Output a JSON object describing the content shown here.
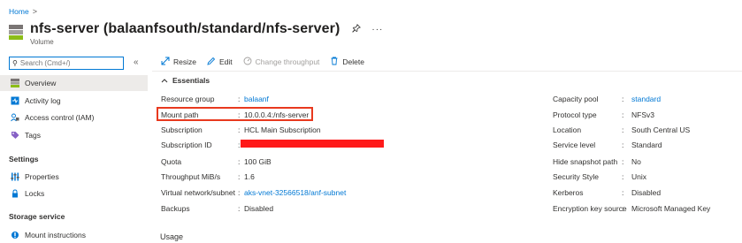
{
  "breadcrumb": {
    "home": "Home",
    "separator": ">"
  },
  "header": {
    "title": "nfs-server (balaanfsouth/standard/nfs-server)",
    "subtitle": "Volume",
    "pin_glyph": "📌",
    "more_glyph": "···"
  },
  "sidebar": {
    "search_placeholder": "Search (Cmd+/)",
    "collapse_glyph": "«",
    "items": [
      {
        "label": "Overview",
        "icon": "volume-icon"
      },
      {
        "label": "Activity log",
        "icon": "activity-log-icon"
      },
      {
        "label": "Access control (IAM)",
        "icon": "iam-icon"
      },
      {
        "label": "Tags",
        "icon": "tag-icon"
      }
    ],
    "sections": [
      {
        "label": "Settings",
        "items": [
          {
            "label": "Properties",
            "icon": "properties-icon"
          },
          {
            "label": "Locks",
            "icon": "lock-icon"
          }
        ]
      },
      {
        "label": "Storage service",
        "items": [
          {
            "label": "Mount instructions",
            "icon": "mount-icon"
          }
        ]
      }
    ]
  },
  "toolbar": {
    "resize": "Resize",
    "edit": "Edit",
    "change_throughput": "Change throughput",
    "delete": "Delete"
  },
  "essentials": {
    "label": "Essentials",
    "left": [
      {
        "key": "Resource group",
        "value": "balaanf",
        "link": true
      },
      {
        "key": "Mount path",
        "value": "10.0.0.4:/nfs-server",
        "link": false
      },
      {
        "key": "Subscription",
        "value": "HCL Main Subscription",
        "link": false
      },
      {
        "key": "Subscription ID",
        "value": "",
        "link": false
      },
      {
        "key": "Quota",
        "value": "100 GiB",
        "link": false
      },
      {
        "key": "Throughput MiB/s",
        "value": "1.6",
        "link": false
      },
      {
        "key": "Virtual network/subnet",
        "value": "aks-vnet-32566518/anf-subnet",
        "link": true
      },
      {
        "key": "Backups",
        "value": "Disabled",
        "link": false
      }
    ],
    "right": [
      {
        "key": "Capacity pool",
        "value": "standard",
        "link": true
      },
      {
        "key": "Protocol type",
        "value": "NFSv3",
        "link": false
      },
      {
        "key": "Location",
        "value": "South Central US",
        "link": false
      },
      {
        "key": "Service level",
        "value": "Standard",
        "link": false
      },
      {
        "key": "Hide snapshot path",
        "value": "No",
        "link": false
      },
      {
        "key": "Security Style",
        "value": "Unix",
        "link": false
      },
      {
        "key": "Kerberos",
        "value": "Disabled",
        "link": false
      },
      {
        "key": "Encryption key source",
        "value": "Microsoft Managed Key",
        "link": false
      }
    ]
  },
  "usage": {
    "label": "Usage"
  },
  "colors": {
    "accent": "#0078d4",
    "highlight": "#e8391e",
    "redaction": "#ff1a1a"
  }
}
